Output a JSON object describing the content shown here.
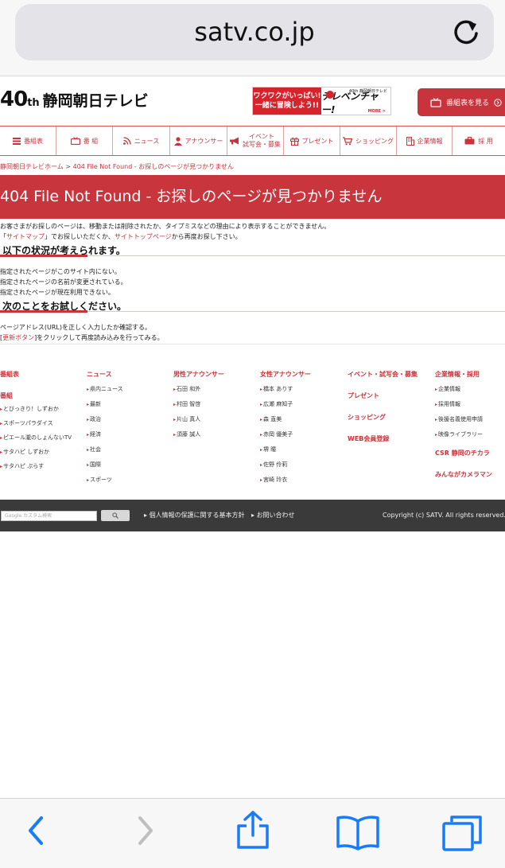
{
  "browser": {
    "url": "satv.co.jp"
  },
  "header": {
    "logo_40": "40",
    "logo_th": "th",
    "logo_name": "静岡朝日テレビ",
    "banner_line1": "ワクワクがいっぱい!",
    "banner_line2": "一緒に冒険しよう!!",
    "banner_brand": "テレベンチャー!",
    "banner_small": "40th 静岡朝日テレビ",
    "banner_more": "MORE >",
    "program_button": "番組表を見る"
  },
  "nav": {
    "items": [
      {
        "label": "番組表"
      },
      {
        "label": "番 組"
      },
      {
        "label": "ニュース"
      },
      {
        "label": "アナウンサー"
      },
      {
        "label": "イベント\n試写会・募集"
      },
      {
        "label": "プレゼント"
      },
      {
        "label": "ショッピング"
      },
      {
        "label": "企業情報"
      },
      {
        "label": "採 用"
      }
    ]
  },
  "breadcrumb": {
    "home": "静岡朝日テレビホーム",
    "sep": " > ",
    "current": "404 File Not Found - お探しのページが見つかりません"
  },
  "page": {
    "title": "404 File Not Found - お探しのページが見つかりません",
    "intro1": "お客さまがお探しのページは、移動または削除されたか、タイプミスなどの理由により表示することができません。",
    "intro2_a": "「",
    "intro2_sitemap": "サイトマップ",
    "intro2_b": "」でお探しいただくか、",
    "intro2_top": "サイトトップページ",
    "intro2_c": "から再度お探し下さい。",
    "section1_title": "以下の状況が考えられます。",
    "section1_lines": [
      "指定されたページがこのサイト内にない。",
      "指定されたページの名前が変更されている。",
      "指定されたページが現在利用できない。"
    ],
    "section2_title": "次のことをお試しください。",
    "section2_line1": "ページアドレス(URL)を正しく入力したか確認する。",
    "section2_line2_a": "[",
    "section2_line2_link": "更新ボタン",
    "section2_line2_b": "]をクリックして再度読み込みを行ってみる。"
  },
  "footer_columns": {
    "col1": {
      "head": "番組表",
      "head2": "番組",
      "items": [
        "とびっきり！しずおか",
        "スポーツパラダイス",
        "ピエール瀧のしょんないTV",
        "サタハピ しずおか",
        "サタハピ ぷらす"
      ]
    },
    "col2": {
      "head": "ニュース",
      "items": [
        "県内ニュース",
        "最新",
        "政治",
        "経済",
        "社会",
        "国際",
        "スポーツ"
      ]
    },
    "col3": {
      "head": "男性アナウンサー",
      "items": [
        "石田 和外",
        "村田 智啓",
        "片山 真人",
        "須藤 誠人"
      ]
    },
    "col4": {
      "head": "女性アナウンサー",
      "items": [
        "橋本 ありす",
        "広瀬 麻知子",
        "森 直美",
        "赤岡 優美子",
        "堺 瞳",
        "佐野 伶莉",
        "宮崎 玲衣"
      ]
    },
    "col5": {
      "head": "イベント・試写会・募集",
      "head2": "プレゼント",
      "head3": "ショッピング",
      "head4": "WEB会員登録"
    },
    "col6": {
      "head": "企業情報・採用",
      "items": [
        "企業情報",
        "採用情報",
        "後援名義使用申請",
        "映像ライブラリー"
      ],
      "head2": "CSR 静岡のチカラ",
      "head3": "みんながカメラマン"
    }
  },
  "dark_footer": {
    "search_placeholder": "Google カスタム検索",
    "privacy": "個人情報の保護に関する基本方針",
    "contact": "お問い合わせ",
    "copyright": "Copyright (c) SATV. All rights reserved."
  },
  "colors": {
    "accent": "#c9353c",
    "ios_blue": "#1a7cf5"
  }
}
